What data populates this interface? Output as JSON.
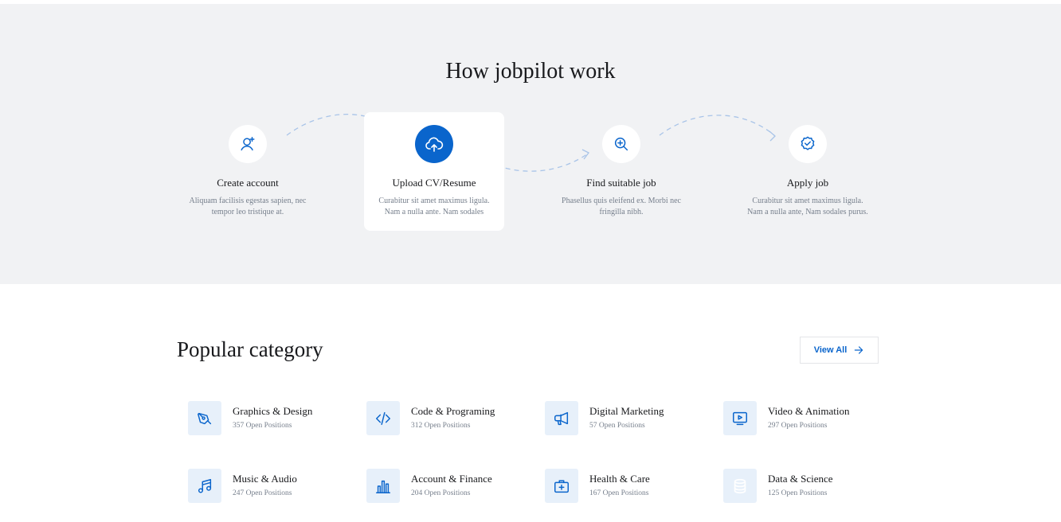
{
  "how_it_works": {
    "title": "How jobpilot work",
    "steps": [
      {
        "title": "Create account",
        "desc_line1": "Aliquam facilisis egestas sapien, nec",
        "desc_line2": "tempor leo tristique at.",
        "icon": "user-plus-icon"
      },
      {
        "title": "Upload CV/Resume",
        "desc_line1": "Curabitur sit amet maximus ligula.",
        "desc_line2": "Nam a nulla ante. Nam sodales",
        "icon": "cloud-upload-icon"
      },
      {
        "title": "Find suitable job",
        "desc_line1": "Phasellus quis eleifend ex. Morbi nec",
        "desc_line2": "fringilla nibh.",
        "icon": "magnifier-plus-icon"
      },
      {
        "title": "Apply job",
        "desc_line1": "Curabitur sit amet maximus ligula.",
        "desc_line2": "Nam a nulla ante, Nam sodales purus.",
        "icon": "badge-check-icon"
      }
    ]
  },
  "popular": {
    "title": "Popular category",
    "view_all_label": "View All",
    "categories": [
      {
        "name": "Graphics & Design",
        "count": "357 Open Positions",
        "icon": "pen-tool-icon"
      },
      {
        "name": "Code & Programing",
        "count": "312 Open Positions",
        "icon": "code-icon"
      },
      {
        "name": "Digital Marketing",
        "count": "57 Open Positions",
        "icon": "megaphone-icon"
      },
      {
        "name": "Video & Animation",
        "count": "297 Open Positions",
        "icon": "monitor-play-icon"
      },
      {
        "name": "Music & Audio",
        "count": "247 Open Positions",
        "icon": "music-note-icon"
      },
      {
        "name": "Account & Finance",
        "count": "204 Open Positions",
        "icon": "bar-chart-icon"
      },
      {
        "name": "Health & Care",
        "count": "167 Open Positions",
        "icon": "first-aid-kit-icon"
      },
      {
        "name": "Data & Science",
        "count": "125 Open Positions",
        "icon": "database-icon"
      }
    ]
  },
  "colors": {
    "primary": "#0a65cc",
    "section_bg": "#f1f2f4",
    "icon_bg": "#e7f0fa",
    "heading": "#18191c",
    "muted": "#767f8c"
  }
}
